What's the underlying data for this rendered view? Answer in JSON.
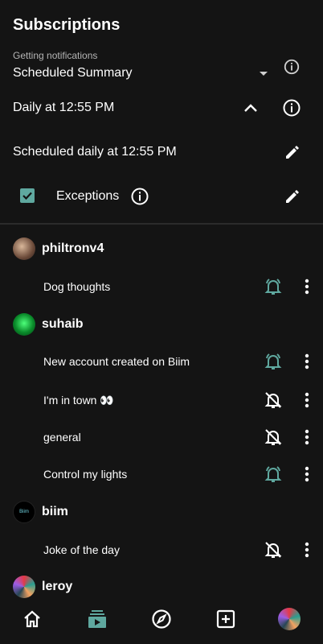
{
  "header": {
    "title": "Subscriptions"
  },
  "notifications": {
    "label": "Getting notifications",
    "mode": "Scheduled Summary",
    "schedule": "Daily at 12:55 PM",
    "scheduled_text": "Scheduled daily at 12:55 PM",
    "exceptions_label": "Exceptions",
    "exceptions_checked": true
  },
  "groups": [
    {
      "name": "philtronv4",
      "topics": [
        {
          "name": "Dog thoughts",
          "bell": "active"
        }
      ]
    },
    {
      "name": "suhaib",
      "topics": [
        {
          "name": "New account created on Biim",
          "bell": "active"
        },
        {
          "name": "I'm in town 👀",
          "bell": "off"
        },
        {
          "name": "general",
          "bell": "off"
        },
        {
          "name": "Control my lights",
          "bell": "active"
        }
      ]
    },
    {
      "name": "biim",
      "avatar_text": "Biim",
      "topics": [
        {
          "name": "Joke of the day",
          "bell": "off"
        }
      ]
    },
    {
      "name": "leroy",
      "topics": []
    }
  ],
  "colors": {
    "accent": "#5fa89f",
    "background": "#141414",
    "divider": "#2b2b2b"
  },
  "nav": {
    "items": [
      "home-icon",
      "subscriptions-icon",
      "explore-icon",
      "add-icon",
      "profile-avatar"
    ]
  }
}
